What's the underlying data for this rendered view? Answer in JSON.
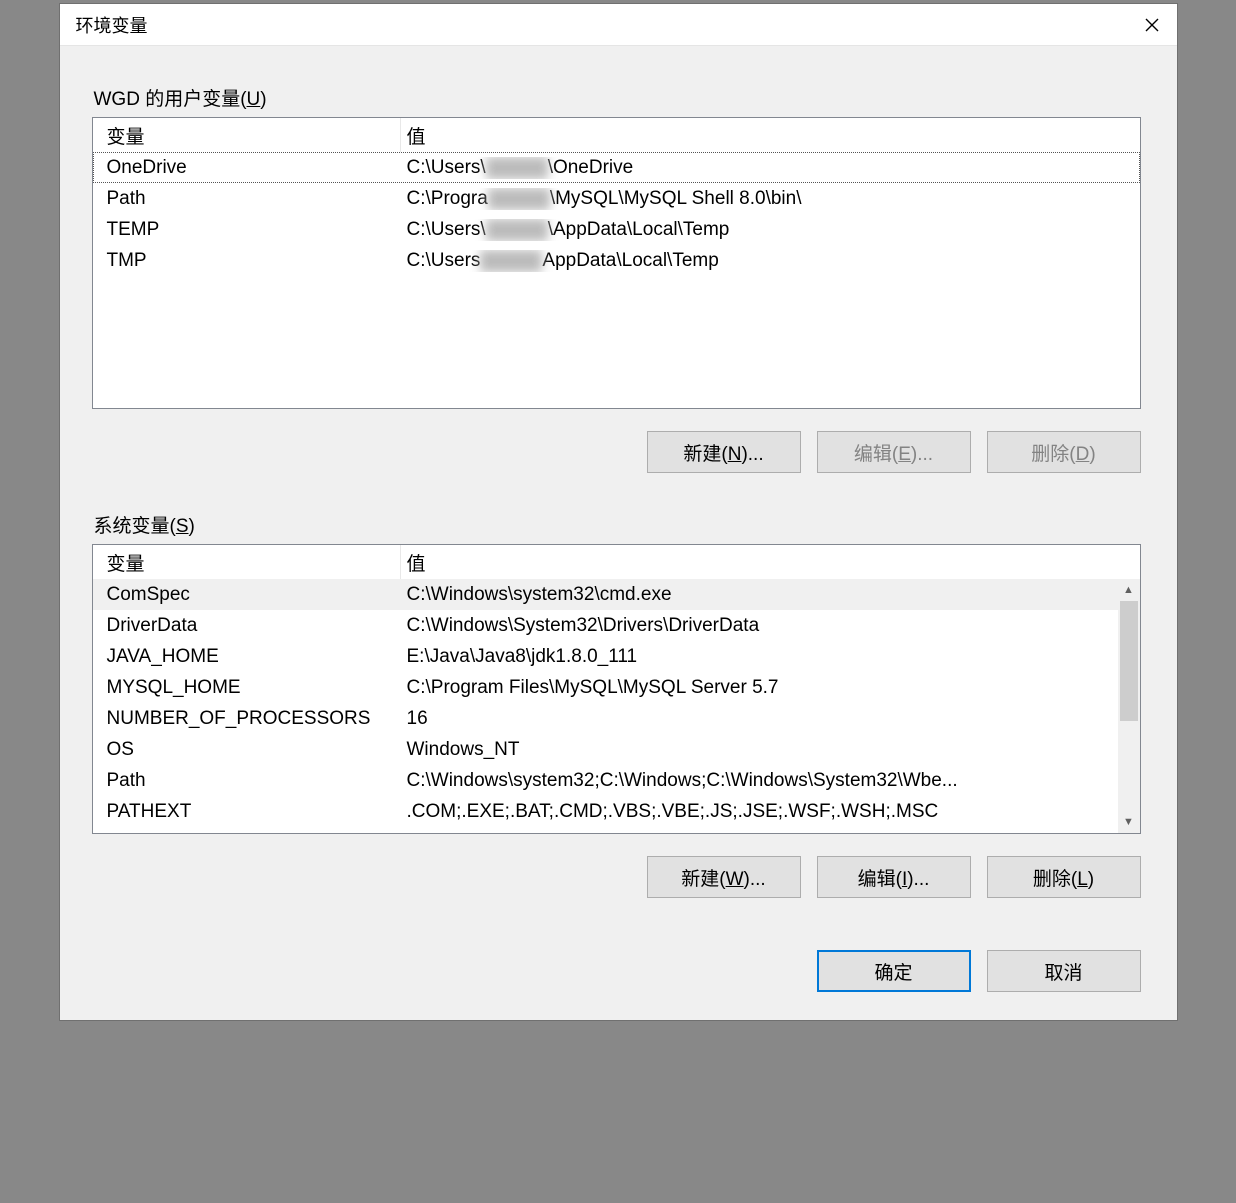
{
  "dialog": {
    "title": "环境变量"
  },
  "userSection": {
    "label_prefix": "WGD 的用户变量(",
    "label_underline": "U",
    "label_suffix": ")",
    "headers": {
      "variable": "变量",
      "value": "值"
    },
    "rows": [
      {
        "name": "OneDrive",
        "value_before": "C:\\Users\\",
        "value_after": "\\OneDrive",
        "blurred": true
      },
      {
        "name": "Path",
        "value_before": "C:\\Progra",
        "value_after": "\\MySQL\\MySQL Shell 8.0\\bin\\",
        "blurred": true
      },
      {
        "name": "TEMP",
        "value_before": "C:\\Users\\",
        "value_after": "\\AppData\\Local\\Temp",
        "blurred": true
      },
      {
        "name": "TMP",
        "value_before": "C:\\Users",
        "value_after": "AppData\\Local\\Temp",
        "blurred": true
      }
    ],
    "buttons": {
      "new_prefix": "新建(",
      "new_u": "N",
      "new_suffix": ")...",
      "edit_prefix": "编辑(",
      "edit_u": "E",
      "edit_suffix": ")...",
      "delete_prefix": "删除(",
      "delete_u": "D",
      "delete_suffix": ")"
    }
  },
  "systemSection": {
    "label_prefix": "系统变量(",
    "label_underline": "S",
    "label_suffix": ")",
    "headers": {
      "variable": "变量",
      "value": "值"
    },
    "rows": [
      {
        "name": "ComSpec",
        "value": "C:\\Windows\\system32\\cmd.exe"
      },
      {
        "name": "DriverData",
        "value": "C:\\Windows\\System32\\Drivers\\DriverData"
      },
      {
        "name": "JAVA_HOME",
        "value": "E:\\Java\\Java8\\jdk1.8.0_111"
      },
      {
        "name": "MYSQL_HOME",
        "value": "C:\\Program Files\\MySQL\\MySQL Server 5.7"
      },
      {
        "name": "NUMBER_OF_PROCESSORS",
        "value": "16"
      },
      {
        "name": "OS",
        "value": "Windows_NT"
      },
      {
        "name": "Path",
        "value": "C:\\Windows\\system32;C:\\Windows;C:\\Windows\\System32\\Wbe..."
      },
      {
        "name": "PATHEXT",
        "value": ".COM;.EXE;.BAT;.CMD;.VBS;.VBE;.JS;.JSE;.WSF;.WSH;.MSC"
      }
    ],
    "buttons": {
      "new_prefix": "新建(",
      "new_u": "W",
      "new_suffix": ")...",
      "edit_prefix": "编辑(",
      "edit_u": "I",
      "edit_suffix": ")...",
      "delete_prefix": "删除(",
      "delete_u": "L",
      "delete_suffix": ")"
    }
  },
  "dialogButtons": {
    "ok": "确定",
    "cancel": "取消"
  }
}
